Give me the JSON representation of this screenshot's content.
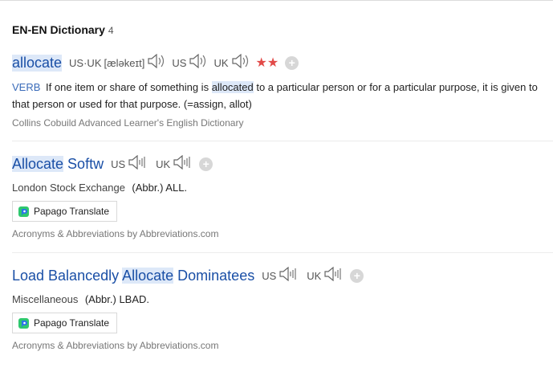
{
  "section": {
    "title": "EN-EN Dictionary",
    "count": "4"
  },
  "entry1": {
    "word": "allocate",
    "pron_tag": "US·UK",
    "pron": "[æləkeɪt]",
    "us": "US",
    "uk": "UK",
    "stars": "★★",
    "pos": "VERB",
    "def_before": "If one item or share of something is ",
    "def_hl": "allocated",
    "def_after": " to a particular person or for a particular purpose, it is given to that person or used for that purpose. (=assign, allot)",
    "source": "Collins Cobuild Advanced Learner's English Dictionary"
  },
  "entry2": {
    "word_hl": "Allocate",
    "word_rest": " Softw",
    "us": "US",
    "uk": "UK",
    "category": "London Stock Exchange",
    "abbr": "(Abbr.) ALL.",
    "papago": "Papago Translate",
    "source": "Acronyms & Abbreviations by Abbreviations.com"
  },
  "entry3": {
    "word_a": "Load Balancedly ",
    "word_hl": "Allocate",
    "word_b": " Dominatees",
    "us": "US",
    "uk": "UK",
    "category": "Miscellaneous",
    "abbr": "(Abbr.) LBAD.",
    "papago": "Papago Translate",
    "source": "Acronyms & Abbreviations by Abbreviations.com"
  },
  "colors": {
    "link": "#1a4fa6",
    "highlight": "#dde8f8",
    "star": "#e24a48"
  },
  "icons": {
    "speaker": "speaker-icon",
    "add": "plus-icon",
    "papago": "papago-icon"
  }
}
